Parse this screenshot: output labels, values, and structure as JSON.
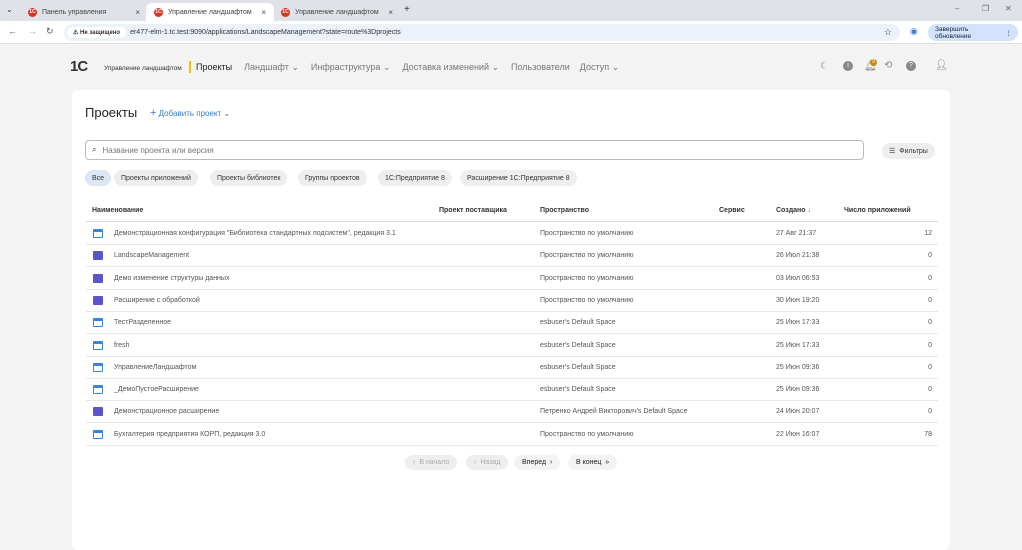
{
  "browser": {
    "tabs": [
      {
        "label": "Панель управления"
      },
      {
        "label": "Управление ландшафтом"
      },
      {
        "label": "Управление ландшафтом"
      }
    ],
    "security": "Не защищено",
    "url": "er477-elm-1.tc.test:9090/applications/LandscapeManagement?state=route%3Dprojects",
    "update_button": "Завершить обновление"
  },
  "header": {
    "logo": "1С",
    "app_name": "Управление ландшафтом",
    "nav": [
      {
        "label": "Проекты",
        "active": true
      },
      {
        "label": "Ландшафт"
      },
      {
        "label": "Инфраструктура"
      },
      {
        "label": "Доставка изменений"
      },
      {
        "label": "Пользователи"
      },
      {
        "label": "Доступ"
      }
    ],
    "notification_badge": "9"
  },
  "page": {
    "title": "Проекты",
    "add_button": "Добавить проект",
    "search_placeholder": "Название проекта или версия",
    "filters_button": "Фильтры",
    "chips": [
      "Все",
      "Проекты приложений",
      "Проекты библиотек",
      "Группы проектов",
      "1С:Предприятие 8",
      "Расширение 1С:Предприятие 8"
    ],
    "columns": [
      "Наименование",
      "Проект поставщика",
      "Пространство",
      "Сервис",
      "Создано",
      "Число приложений"
    ],
    "rows": [
      {
        "type": "config",
        "name": "Демонстрационная конфигурация \"Библиотека стандартных подсистем\", редакция 3.1",
        "space": "Пространство по умолчанию",
        "created": "27 Авг 21:37",
        "count": "12"
      },
      {
        "type": "extension",
        "name": "LandscapeManagement",
        "space": "Пространство по умолчанию",
        "created": "26 Июл 21:38",
        "count": "0"
      },
      {
        "type": "extension",
        "name": "Демо изменение структуры данных",
        "space": "Пространство по умолчанию",
        "created": "03 Июл 06:53",
        "count": "0"
      },
      {
        "type": "extension",
        "name": "Расширение с обработкой",
        "space": "Пространство по умолчанию",
        "created": "30 Июн 19:20",
        "count": "0"
      },
      {
        "type": "config",
        "name": "ТестРазделенное",
        "space": "esbuser's Default Space",
        "created": "25 Июн 17:33",
        "count": "0"
      },
      {
        "type": "config",
        "name": "fresh",
        "space": "esbuser's Default Space",
        "created": "25 Июн 17:33",
        "count": "0"
      },
      {
        "type": "config",
        "name": "УправлениеЛандшафтом",
        "space": "esbuser's Default Space",
        "created": "25 Июн 09:36",
        "count": "0"
      },
      {
        "type": "config",
        "name": "_ДемоПустоеРасширение",
        "space": "esbuser's Default Space",
        "created": "25 Июн 09:36",
        "count": "0"
      },
      {
        "type": "extension",
        "name": "Демонстрационное расширение",
        "space": "Петренко Андрей Викторович's Default Space",
        "created": "24 Июн 20:07",
        "count": "0"
      },
      {
        "type": "config",
        "name": "Бухгалтерия предприятия КОРП, редакция 3.0",
        "space": "Пространство по умолчанию",
        "created": "22 Июн 16:07",
        "count": "78"
      }
    ],
    "pagination": {
      "first": "В начало",
      "prev": "Назад",
      "next": "Вперед",
      "last": "В конец"
    }
  },
  "colors": {
    "accent": "#3a7bd5",
    "active_nav_marker": "#f5c400",
    "extension_icon": "#5b55c9",
    "config_icon": "#3a86d6"
  }
}
